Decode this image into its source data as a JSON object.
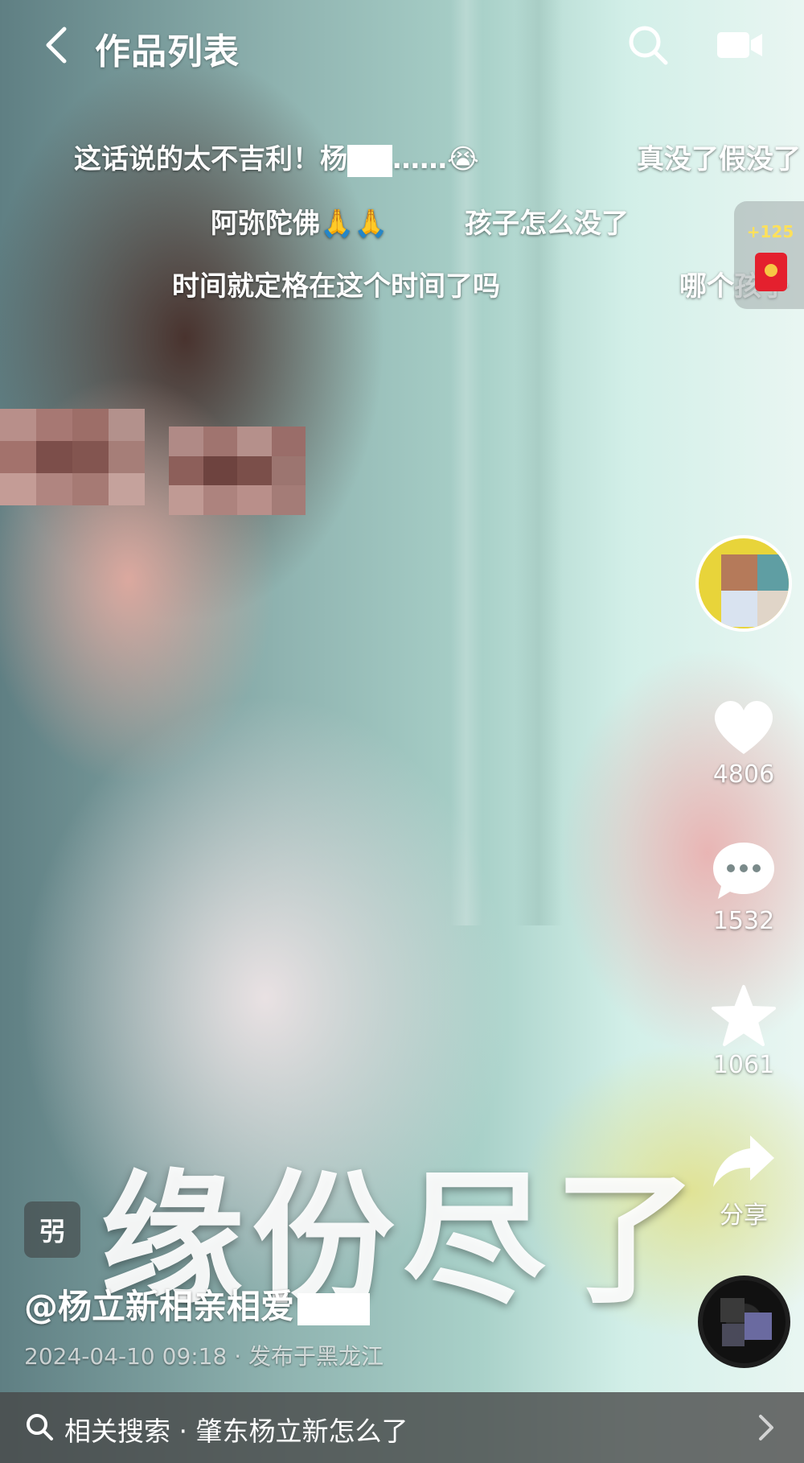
{
  "header": {
    "title": "作品列表",
    "back_icon": "chevron-left-icon",
    "search_icon": "search-icon",
    "camera_icon": "camera-icon"
  },
  "danmaku": [
    {
      "text": "这话说的太不吉利！杨",
      "suffix": "……😭"
    },
    {
      "text": "真没了假没了"
    },
    {
      "text": "阿弥陀佛🙏🙏"
    },
    {
      "text": "孩子怎么没了"
    },
    {
      "text": "时间就定格在这个时间了吗"
    },
    {
      "text": "哪个孩子"
    }
  ],
  "reward": {
    "count": "+125",
    "icon": "red-envelope-icon"
  },
  "actions": {
    "like": {
      "count": "4806",
      "icon": "heart-icon"
    },
    "comment": {
      "count": "1532",
      "icon": "comment-icon"
    },
    "favorite": {
      "count": "1061",
      "icon": "star-icon"
    },
    "share": {
      "label": "分享",
      "icon": "share-icon"
    }
  },
  "video": {
    "caption": "缘份尽了",
    "tag": "弜"
  },
  "post": {
    "author": "@杨立新相亲相爱",
    "date": "2024-04-10 09:18",
    "location": "· 发布于黑龙江"
  },
  "related_search": {
    "text": "相关搜索 · 肇东杨立新怎么了",
    "icon": "search-icon",
    "chevron": "chevron-right-icon"
  },
  "colors": {
    "accent_yellow": "#ffe15a",
    "red_envelope": "#e4202e",
    "bottom_bar": "#464646"
  }
}
